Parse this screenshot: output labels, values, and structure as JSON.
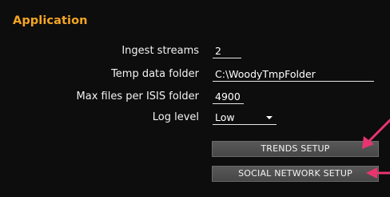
{
  "section": {
    "title": "Application"
  },
  "fields": [
    {
      "label": "Ingest streams",
      "value": "2"
    },
    {
      "label": "Temp data folder",
      "value": "C:\\WoodyTmpFolder"
    },
    {
      "label": "Max files per ISIS folder",
      "value": "4900"
    },
    {
      "label": "Log level",
      "value": "Low"
    }
  ],
  "buttons": {
    "trends_setup": "TRENDS SETUP",
    "social_network_setup": "SOCIAL NETWORK SETUP"
  },
  "colors": {
    "background": "#0d0d0d",
    "title": "#f5a623",
    "arrow": "#e8356f",
    "button": "#505050"
  },
  "annotations": {
    "arrow_icon": "pink-arrow-icon"
  }
}
